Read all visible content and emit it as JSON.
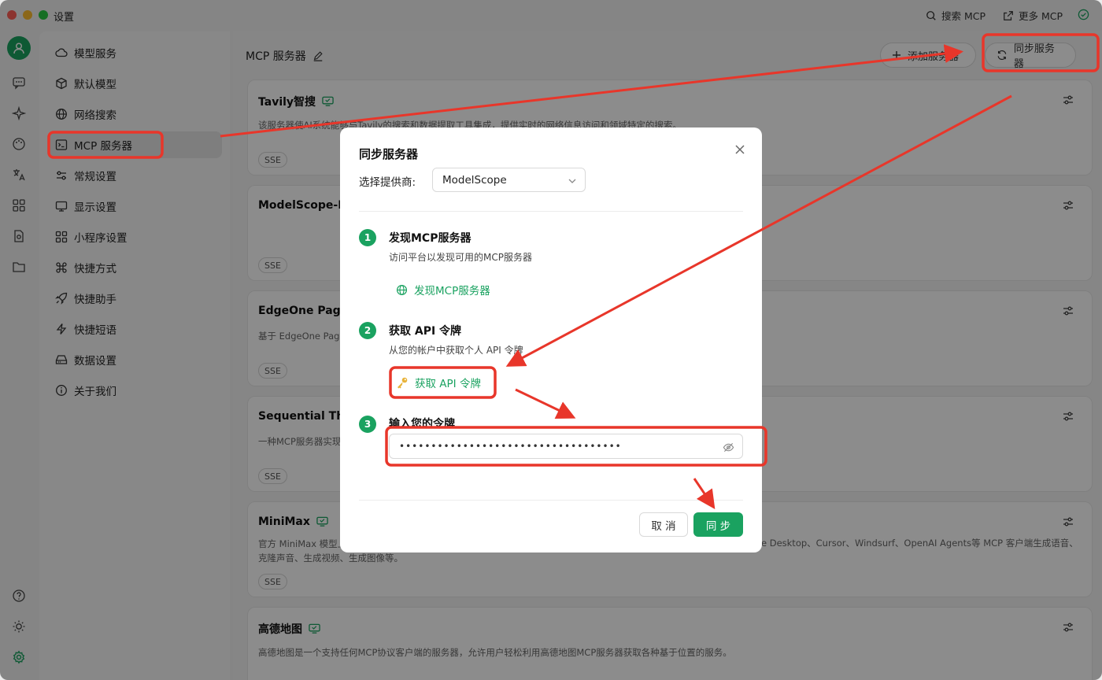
{
  "window": {
    "title": "设置"
  },
  "titlebar": {
    "search_mcp": "搜索 MCP",
    "more_mcp": "更多 MCP"
  },
  "nav": {
    "items": [
      {
        "label": "模型服务",
        "icon": "cloud-icon"
      },
      {
        "label": "默认模型",
        "icon": "cube-icon"
      },
      {
        "label": "网络搜索",
        "icon": "globe-icon"
      },
      {
        "label": "MCP 服务器",
        "icon": "terminal-icon",
        "active": true
      },
      {
        "label": "常规设置",
        "icon": "sliders-icon"
      },
      {
        "label": "显示设置",
        "icon": "monitor-icon"
      },
      {
        "label": "小程序设置",
        "icon": "grid-icon"
      },
      {
        "label": "快捷方式",
        "icon": "command-icon"
      },
      {
        "label": "快捷助手",
        "icon": "rocket-icon"
      },
      {
        "label": "快捷短语",
        "icon": "zap-icon"
      },
      {
        "label": "数据设置",
        "icon": "hard-drive-icon"
      },
      {
        "label": "关于我们",
        "icon": "info-icon"
      }
    ]
  },
  "main": {
    "title": "MCP 服务器",
    "add_button": "添加服务器",
    "sync_button": "同步服务器",
    "cards": [
      {
        "title": "Tavily智搜",
        "desc": "该服务器使AI系统能够与Tavily的搜索和数据提取工具集成，提供实时的网络信息访问和领域特定的搜索。",
        "tag": "SSE"
      },
      {
        "title": "ModelScope-Im",
        "desc": "",
        "tag": "SSE"
      },
      {
        "title": "EdgeOne Pages",
        "desc": "基于 EdgeOne Page",
        "tag": "SSE"
      },
      {
        "title": "Sequential Thin",
        "desc": "一种MCP服务器实现",
        "tag": "SSE"
      },
      {
        "title": "MiniMax",
        "desc": "官方 MiniMax 模型上",
        "desc_right": "e Desktop、Cursor、Windsurf、OpenAI Agents等 MCP 客户端生成语音、",
        "desc2": "克隆声音、生成视频、生成图像等。",
        "tag": "SSE"
      },
      {
        "title": "高德地图",
        "desc": "高德地图是一个支持任何MCP协议客户端的服务器，允许用户轻松利用高德地图MCP服务器获取各种基于位置的服务。",
        "tag": ""
      }
    ]
  },
  "modal": {
    "title": "同步服务器",
    "provider_label": "选择提供商:",
    "provider_value": "ModelScope",
    "steps": [
      {
        "num": "1",
        "title": "发现MCP服务器",
        "desc": "访问平台以发现可用的MCP服务器",
        "link": "发现MCP服务器"
      },
      {
        "num": "2",
        "title": "获取 API 令牌",
        "desc": "从您的帐户中获取个人 API 令牌",
        "link": "获取 API 令牌"
      },
      {
        "num": "3",
        "title": "输入您的令牌",
        "desc": "",
        "input_value": "•••••••••••••••••••••••••••••••••••"
      }
    ],
    "cancel": "取 消",
    "sync": "同 步"
  },
  "colors": {
    "accent": "#1aa260",
    "annotation": "#e8362a"
  }
}
